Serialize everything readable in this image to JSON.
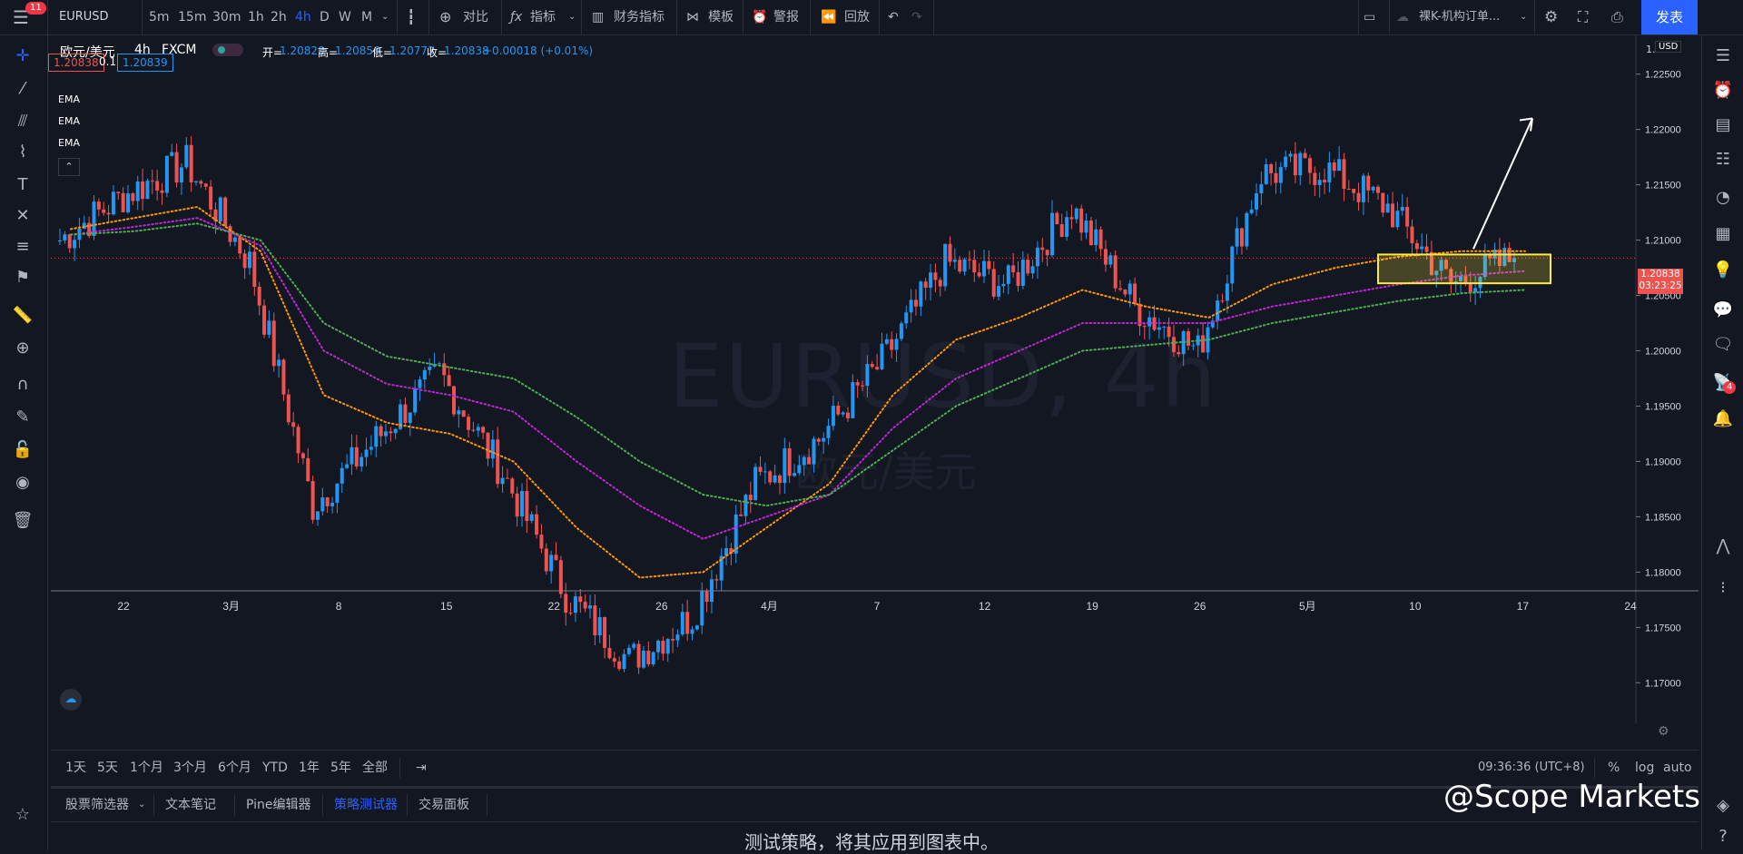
{
  "toolbar": {
    "menu_badge": "11",
    "symbol": "EURUSD",
    "intervals": [
      "5m",
      "15m",
      "30m",
      "1h",
      "2h",
      "4h",
      "D",
      "W",
      "M"
    ],
    "selected_interval": "4h",
    "compare": "对比",
    "indicators": "指标",
    "financials": "财务指标",
    "templates": "模板",
    "alert": "警报",
    "replay": "回放",
    "layout_name": "裸K-机构订单...",
    "publish": "发表"
  },
  "legend": {
    "title": "欧元/美元",
    "interval": "4h",
    "source": "FXCM",
    "open_label": "开=",
    "open": "1.20820",
    "high_label": "高=",
    "high": "1.20856",
    "low_label": "低=",
    "low": "1.20773",
    "close_label": "收=",
    "close": "1.20838",
    "change": "+0.00018 (+0.01%)",
    "bid": "1.20838",
    "spread": "0.1",
    "ask": "1.20839",
    "indicators": [
      "EMA",
      "EMA",
      "EMA"
    ]
  },
  "watermark": {
    "symbol": "EURUSD, 4h",
    "name": "欧元/美元"
  },
  "price_scale": {
    "currency": "USD",
    "top_label": "1.",
    "current_price": "1.20838",
    "countdown": "03:23:25"
  },
  "colors": {
    "bg": "#131722",
    "up": "#2196f3",
    "down": "#ef5350",
    "ema_fast": "#ff9800",
    "ema_mid": "#c026d3",
    "ema_slow": "#4caf50",
    "zone": "#ffeb3b",
    "accent": "#2962ff"
  },
  "chart_data": {
    "type": "candlestick",
    "symbol": "EURUSD",
    "timeframe": "4h",
    "ylim": [
      1.1665,
      1.2285
    ],
    "y_ticks": [
      "1.22500",
      "1.22000",
      "1.21500",
      "1.21000",
      "1.20500",
      "1.20000",
      "1.19500",
      "1.19000",
      "1.18500",
      "1.18000",
      "1.17500",
      "1.17000"
    ],
    "x_ticks": [
      "22",
      "3月",
      "8",
      "15",
      "22",
      "26",
      "4月",
      "7",
      "12",
      "19",
      "26",
      "5月",
      "10",
      "17",
      "24"
    ],
    "candle_shape": {
      "x": [
        "Feb 16",
        "Feb 22",
        "Feb 25",
        "Mar 1",
        "Mar 8",
        "Mar 15",
        "Mar 18",
        "Mar 22",
        "Mar 26",
        "Mar 31",
        "Apr 5",
        "Apr 7",
        "Apr 12",
        "Apr 19",
        "Apr 22",
        "Apr 26",
        "Apr 29",
        "May 3",
        "May 6",
        "May 10",
        "May 11",
        "May 12",
        "May 13",
        "May 14"
      ],
      "close": [
        1.21,
        1.214,
        1.217,
        1.208,
        1.186,
        1.192,
        1.198,
        1.189,
        1.178,
        1.172,
        1.176,
        1.188,
        1.192,
        1.199,
        1.208,
        1.206,
        1.213,
        1.204,
        1.2,
        1.216,
        1.2165,
        1.213,
        1.206,
        1.2084
      ]
    },
    "ema_series": [
      {
        "color": "#ff9800",
        "values": [
          1.211,
          1.212,
          1.213,
          1.209,
          1.196,
          1.1935,
          1.1925,
          1.19,
          1.184,
          1.1795,
          1.18,
          1.184,
          1.188,
          1.196,
          1.201,
          1.203,
          1.2055,
          1.204,
          1.203,
          1.206,
          1.2075,
          1.2085,
          1.209,
          1.209
        ]
      },
      {
        "color": "#c026d3",
        "values": [
          1.2105,
          1.2112,
          1.212,
          1.2095,
          1.2,
          1.197,
          1.196,
          1.1945,
          1.19,
          1.186,
          1.183,
          1.185,
          1.187,
          1.193,
          1.1975,
          1.2,
          1.2025,
          1.2025,
          1.2025,
          1.204,
          1.205,
          1.206,
          1.2068,
          1.2072
        ]
      },
      {
        "color": "#4caf50",
        "values": [
          1.2105,
          1.2108,
          1.2115,
          1.21,
          1.2025,
          1.1995,
          1.1985,
          1.1975,
          1.194,
          1.19,
          1.187,
          1.186,
          1.187,
          1.191,
          1.195,
          1.1975,
          1.2,
          1.2005,
          1.201,
          1.2025,
          1.2035,
          1.2045,
          1.2052,
          1.2055
        ]
      }
    ],
    "last_price": 1.20838,
    "annotations": [
      {
        "type": "rectangle",
        "price_top": 1.2087,
        "price_bottom": 1.2061,
        "color": "#ffeb3b"
      },
      {
        "type": "arrow",
        "from_price": 1.2092,
        "to_price": 1.221,
        "color": "#ffffff"
      }
    ]
  },
  "range_bar": {
    "ranges": [
      "1天",
      "5天",
      "1个月",
      "3个月",
      "6个月",
      "YTD",
      "1年",
      "5年",
      "全部"
    ],
    "time": "09:36:36 (UTC+8)",
    "percent": "%",
    "log": "log",
    "auto": "auto"
  },
  "bottom_tabs": [
    "股票筛选器",
    "文本笔记",
    "Pine编辑器",
    "策略测试器",
    "交易面板"
  ],
  "selected_bottom_tab": "策略测试器",
  "strategy_message": "测试策略，将其应用到图表中。",
  "brand": "@Scope Markets"
}
